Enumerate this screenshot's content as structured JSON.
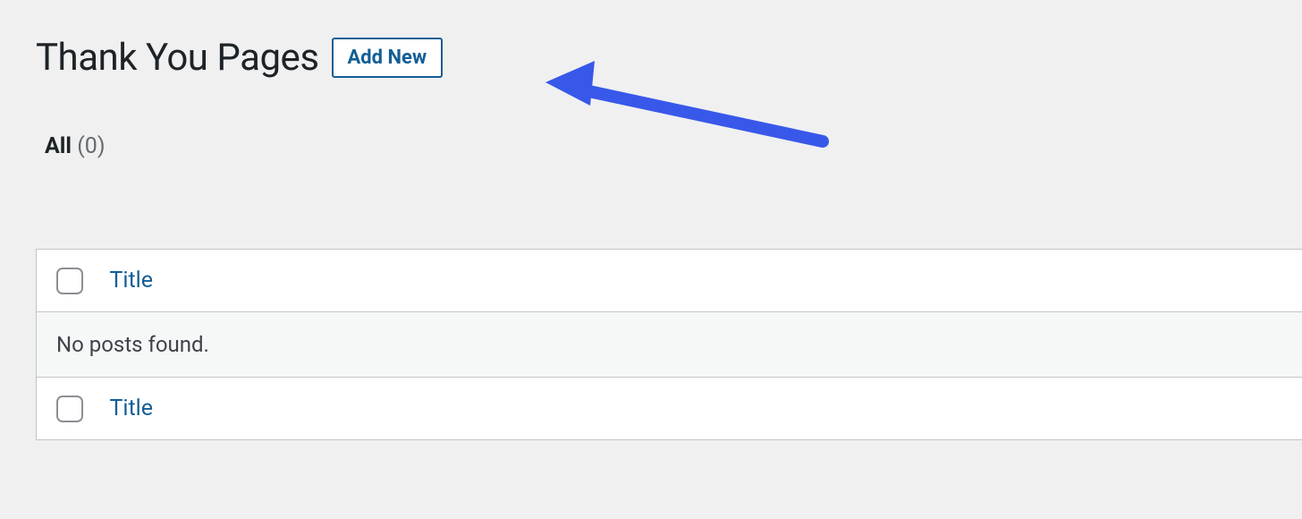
{
  "page": {
    "title": "Thank You Pages",
    "add_new": "Add New"
  },
  "filters": {
    "all_label": "All",
    "all_count": "(0)"
  },
  "table": {
    "title_column": "Title",
    "empty_message": "No posts found."
  },
  "arrow": {
    "color": "#3858e9"
  }
}
